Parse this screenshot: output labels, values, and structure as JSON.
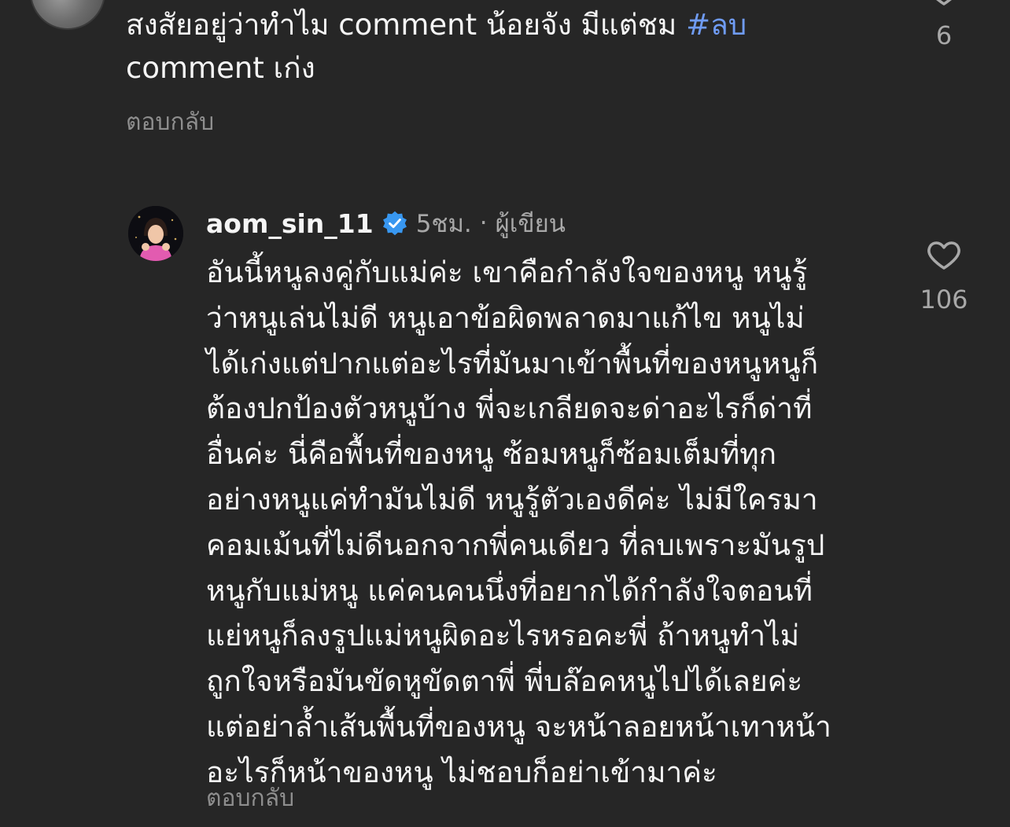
{
  "comment_top": {
    "text_main": "สงสัยอยู่ว่าทำไม comment น้อยจัง มีแต่ชม ",
    "hashtag": "#ลบ",
    "text_end": " comment เก่ง",
    "like_count": "6",
    "reply_label": "ตอบกลับ"
  },
  "comment_main": {
    "username": "aom_sin_11",
    "time": "5ชม.",
    "separator": "·",
    "author_badge": "ผู้เขียน",
    "lines": [
      "อันนี้หนูลงคู่กับแม่ค่ะ เขาคือกำลังใจของหนู หนูรู้",
      "ว่าหนูเล่นไม่ดี หนูเอาข้อผิดพลาดมาแก้ไข หนูไม่",
      "ได้เก่งแต่ปากแต่อะไรที่มันมาเข้าพื้นที่ของหนูหนูก็",
      "ต้องปกป้องตัวหนูบ้าง พี่จะเกลียดจะด่าอะไรก็ด่าที่",
      "อื่นค่ะ นี่คือพื้นที่ของหนู ซ้อมหนูก็ซ้อมเต็มที่ทุก",
      "อย่างหนูแค่ทำมันไม่ดี หนูรู้ตัวเองดีค่ะ ไม่มีใครมา",
      "คอมเม้นที่ไม่ดีนอกจากพี่คนเดียว ที่ลบเพราะมันรูป",
      "หนูกับแม่หนู แค่คนคนนึ่งที่อยากได้กำลังใจตอนที่",
      "แย่หนูก็ลงรูปแม่หนูผิดอะไรหรอคะพี่ ถ้าหนูทำไม่",
      "ถูกใจหรือมันขัดหูขัดตาพี่ พี่บล๊อคหนูไปได้เลยค่ะ",
      "แต่อย่าล้ำเส้นพื้นที่ของหนู จะหน้าลอยหน้าเทาหน้า",
      "อะไรก็หน้าของหนู ไม่ชอบก็อย่าเข้ามาค่ะ"
    ],
    "like_count": "106",
    "reply_label": "ตอบกลับ"
  },
  "colors": {
    "background": "#262626",
    "text": "#f5f5f5",
    "muted": "#a8a8a8",
    "hashtag": "#6f9bf3",
    "verified": "#3897f0"
  },
  "icons": {
    "like": "heart-outline-icon",
    "verified": "verified-badge-icon"
  }
}
